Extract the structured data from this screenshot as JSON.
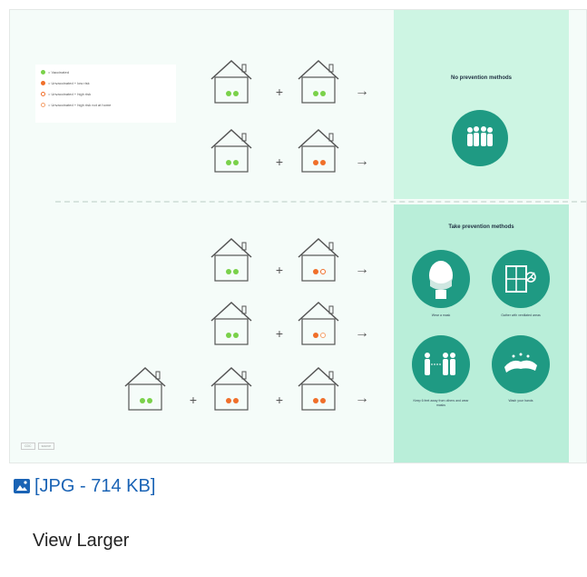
{
  "figure": {
    "legend": [
      {
        "label": "= Vaccinated",
        "marker": "green"
      },
      {
        "label": "= Unvaccinated + low risk",
        "marker": "orange"
      },
      {
        "label": "= Unvaccinated + high risk",
        "marker": "ring"
      },
      {
        "label": "= Unvaccinated + high risk not at home",
        "marker": "ring-light"
      }
    ],
    "top_panel_title": "No prevention methods",
    "bottom_panel_title": "Take prevention methods",
    "prevention_items": [
      {
        "label": "Wear a mask",
        "icon": "masked-face-icon"
      },
      {
        "label": "Gather with ventilated areas",
        "icon": "window-fan-icon"
      },
      {
        "label": "Keep 6 feet away from others and wear masks",
        "icon": "distancing-people-icon"
      },
      {
        "label": "Wash your hands",
        "icon": "handwashing-icon"
      }
    ],
    "credit": [
      "CDC",
      "source"
    ]
  },
  "file_link": {
    "label": "[JPG - 714 KB]",
    "icon": "image-file-icon",
    "color": "#1a63b5"
  },
  "view_larger": {
    "label": "View Larger"
  }
}
